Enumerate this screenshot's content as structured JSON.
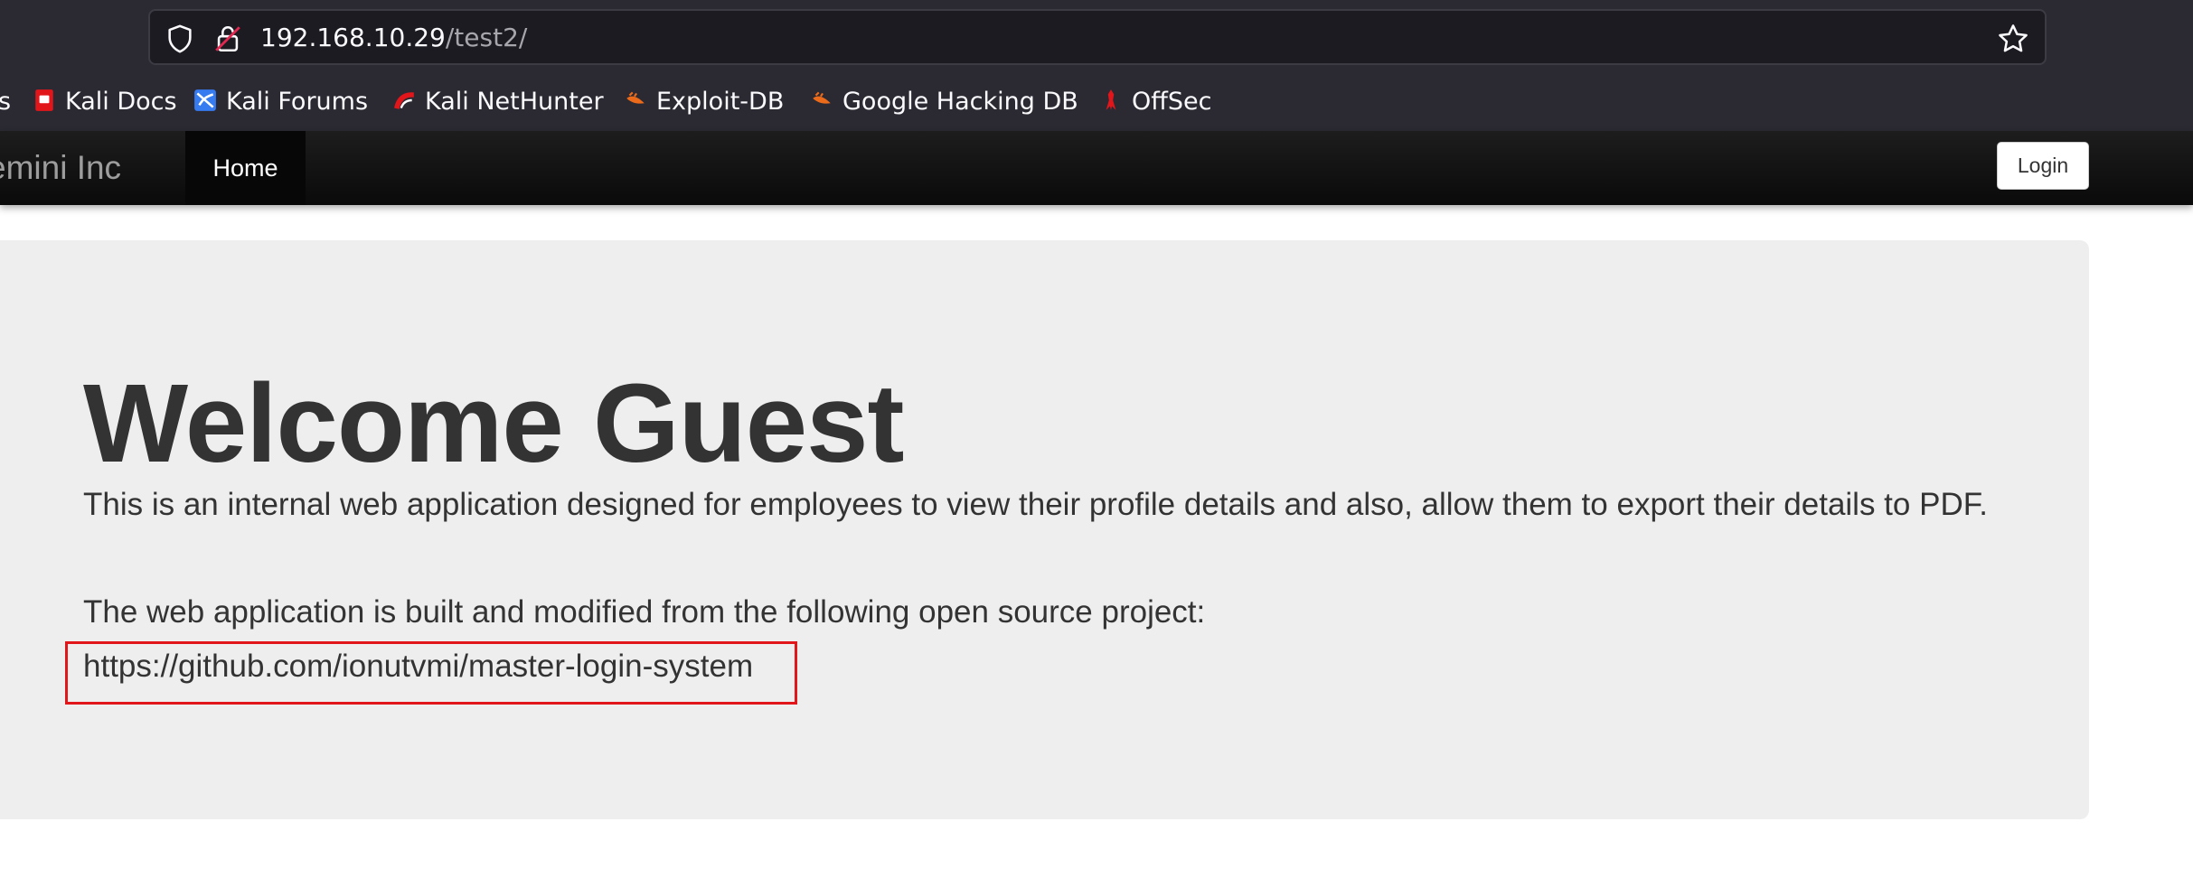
{
  "browser": {
    "url_host": "192.168.10.29",
    "url_path": "/test2/",
    "bookmarks": [
      {
        "label": "s",
        "icon": "cropped-bookmark"
      },
      {
        "label": "Kali Docs",
        "icon": "kali-docs-icon"
      },
      {
        "label": "Kali Forums",
        "icon": "kali-forums-icon"
      },
      {
        "label": "Kali NetHunter",
        "icon": "kali-nethunter-icon"
      },
      {
        "label": "Exploit-DB",
        "icon": "exploit-db-icon"
      },
      {
        "label": "Google Hacking DB",
        "icon": "google-hacking-db-icon"
      },
      {
        "label": "OffSec",
        "icon": "offsec-icon"
      }
    ]
  },
  "navbar": {
    "brand": "emini Inc",
    "home_label": "Home",
    "login_label": "Login"
  },
  "main": {
    "title": "Welcome Guest",
    "paragraph1": "This is an internal web application designed for employees to view their profile details and also, allow them to export their details to PDF.",
    "paragraph2": "The web application is built and modified from the following open source project:",
    "project_link": "https://github.com/ionutvmi/master-login-system"
  },
  "colors": {
    "highlight_box": "#e0161b",
    "jumbotron_bg": "#eeeeee",
    "navbar_bg": "#0a0a0a",
    "chrome_bg": "#2b2a33"
  }
}
